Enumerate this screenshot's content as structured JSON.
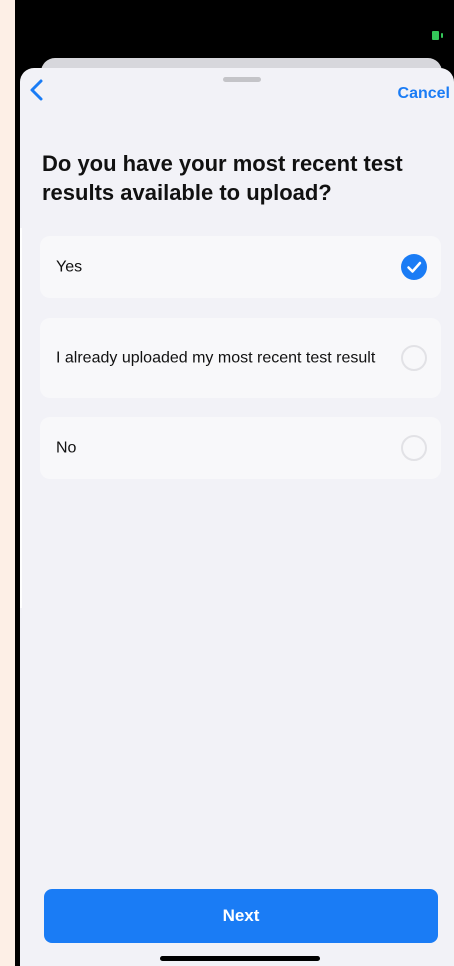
{
  "colors": {
    "accent": "#1a7cf5",
    "background_outer": "#fdefe6",
    "sheet": "#f2f2f7",
    "option_bg": "#f8f8fa",
    "battery": "#34c759"
  },
  "status_bar": {
    "battery_icon": "battery-icon"
  },
  "nav": {
    "back_icon": "chevron-left-icon",
    "cancel_label": "Cancel"
  },
  "question": "Do you have your most recent test results available to upload?",
  "options": [
    {
      "label": "Yes",
      "selected": true
    },
    {
      "label": "I already uploaded my most recent test result",
      "selected": false
    },
    {
      "label": "No",
      "selected": false
    }
  ],
  "footer": {
    "next_label": "Next"
  }
}
